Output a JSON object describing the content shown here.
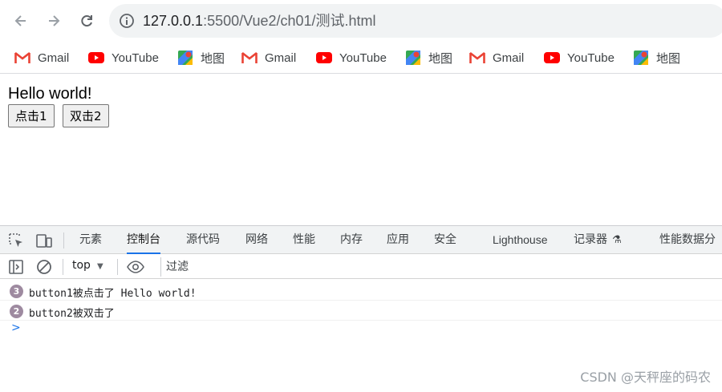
{
  "browser": {
    "url_host": "127.0.0.1",
    "url_path": ":5500/Vue2/ch01/测试.html",
    "bookmarks": [
      {
        "label": "Gmail",
        "icon": "gmail-icon"
      },
      {
        "label": "YouTube",
        "icon": "youtube-icon"
      },
      {
        "label": "地图",
        "icon": "maps-icon"
      },
      {
        "label": "Gmail",
        "icon": "gmail-icon"
      },
      {
        "label": "YouTube",
        "icon": "youtube-icon"
      },
      {
        "label": "地图",
        "icon": "maps-icon"
      },
      {
        "label": "Gmail",
        "icon": "gmail-icon"
      },
      {
        "label": "YouTube",
        "icon": "youtube-icon"
      },
      {
        "label": "地图",
        "icon": "maps-icon"
      }
    ]
  },
  "page": {
    "heading": "Hello world!",
    "button1_label": "点击1",
    "button2_label": "双击2"
  },
  "devtools": {
    "tabs": [
      "元素",
      "控制台",
      "源代码",
      "网络",
      "性能",
      "内存",
      "应用",
      "安全",
      "Lighthouse",
      "记录器",
      "性能数据分"
    ],
    "active_tab": "控制台",
    "context": "top",
    "filter_placeholder": "过滤",
    "logs": [
      {
        "count": "3",
        "text": "button1被点击了 Hello world!"
      },
      {
        "count": "2",
        "text": "button2被双击了"
      }
    ],
    "prompt": ">"
  },
  "watermark": "CSDN @天秤座的码农",
  "colors": {
    "accent": "#1a73e8",
    "badge": "#9e8aa0",
    "gmail_red": "#ea4335",
    "youtube_red": "#ff0000"
  }
}
